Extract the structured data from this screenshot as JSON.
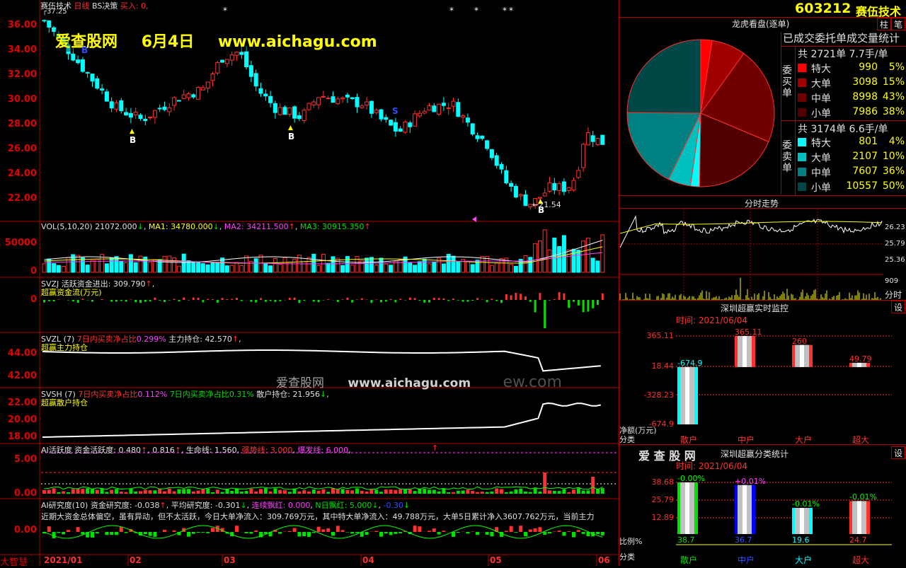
{
  "header": {
    "stock_name": "赛伍技术",
    "period": "日线",
    "strategy": "BS决策",
    "buy_label": "买入:",
    "buy_value": "0,",
    "watermark": "爱查股网",
    "date_banner": "6月4日",
    "url_banner": "www.aichagu.com",
    "price_flag": "37.25"
  },
  "price_pane": {
    "y_ticks": [
      "36.00",
      "34.00",
      "32.00",
      "30.00",
      "28.00",
      "26.00",
      "24.00",
      "22.00"
    ],
    "low_label": "21.54",
    "markers": [
      "B",
      "B",
      "B",
      "S",
      "B"
    ]
  },
  "vol_pane": {
    "label": "VOL(5,10,20)",
    "vol": "21072.000",
    "ma1_label": "MA1:",
    "ma1": "34780.000",
    "ma2_label": "MA2:",
    "ma2": "34211.500",
    "ma3_label": "MA3:",
    "ma3": "30915.350",
    "down_arrow": "↓",
    "up_arrow": "↑",
    "y_ticks": [
      "50000",
      "0"
    ]
  },
  "svzj_pane": {
    "code": "SVZJ",
    "title": "活跃资金进出:",
    "value": "309.790",
    "subtitle": "超赢资金流(万元)",
    "y_tick": "0"
  },
  "svzl_pane": {
    "code": "SVZL",
    "period": "(7)",
    "ratio_label": "7日内买卖净占比",
    "ratio": "0.299%",
    "hold_label": "主力持仓:",
    "hold": "42.570",
    "subtitle": "超赢主力持仓",
    "y_ticks": [
      "44.00",
      "42.00"
    ]
  },
  "svsh_pane": {
    "code": "SVSH",
    "period": "(7)",
    "ratio_label": "7日内买卖净占比",
    "ratio": "0.112%",
    "ratio2_label": "7日内买卖净占比",
    "ratio2": "0.31%",
    "hold_label": "散户持仓:",
    "hold": "21.956",
    "subtitle": "超赢散户持仓",
    "y_ticks": [
      "22.00",
      "20.00",
      "18.00"
    ],
    "watermark_cn": "爱查股网",
    "watermark_url": "www.aichagu.com",
    "watermark_tail": "ew.com"
  },
  "ai_pane": {
    "title": "AI活跃度",
    "fund_label": "资金活跃度:",
    "fund": "0.480",
    "v2": "0.816",
    "life_label": "生命线:",
    "life": "1.560",
    "strong_label": "强势线:",
    "strong": "3.000",
    "burst_label": "爆发线:",
    "burst": "6.000",
    "y_ticks": [
      "5.00",
      "0.00"
    ]
  },
  "research_pane": {
    "title": "AI研究度(10)",
    "r_label": "资金研究度:",
    "r": "-0.038",
    "avg_label": "平均研究度:",
    "avg": "-0.301",
    "cont_label": "连续飘红:",
    "cont": "0.000",
    "nday_label": "N日飘红:",
    "nday": "5.000",
    "neg": "-0.30",
    "comment": "近期大资金总体偏空，虽有异动，但不太活跃，今日大单净流入：309.769万元，其中特大单净流入：49.788万元，大单5日累计净入3607.762万元，当前主力",
    "y_tick": "0.00"
  },
  "x_axis": {
    "labels": [
      "2021/01",
      "02",
      "03",
      "04",
      "05",
      "06"
    ]
  },
  "bottom_left": {
    "label": "大智慧"
  },
  "right_panel": {
    "code": "603212",
    "name": "赛伍技术",
    "btn_zhu": "柱",
    "btn_bi": "笔",
    "pie_title": "龙虎看盘(逐单)",
    "stats_title": "已成交委托单成交量统计",
    "buy_side_label": "委买单",
    "sell_side_label": "委卖单",
    "buy_summary": "共 2721单 7.7手/单",
    "sell_summary": "共 3174单 6.6手/单",
    "buy_rows": [
      {
        "label": "特大",
        "count": "990",
        "pct": "5%",
        "color": "#ff0000"
      },
      {
        "label": "大单",
        "count": "3098",
        "pct": "15%",
        "color": "#a00000"
      },
      {
        "label": "中单",
        "count": "8998",
        "pct": "43%",
        "color": "#700000"
      },
      {
        "label": "小单",
        "count": "7986",
        "pct": "38%",
        "color": "#500000"
      }
    ],
    "sell_rows": [
      {
        "label": "特大",
        "count": "801",
        "pct": "4%",
        "color": "#00ffff"
      },
      {
        "label": "大单",
        "count": "2107",
        "pct": "10%",
        "color": "#00c0c0"
      },
      {
        "label": "中单",
        "count": "7607",
        "pct": "36%",
        "color": "#008080"
      },
      {
        "label": "小单",
        "count": "10557",
        "pct": "50%",
        "color": "#004848"
      }
    ],
    "intraday_title": "分时走势",
    "intraday_ticks": [
      "26.23",
      "25.79",
      "25.36"
    ],
    "intraday_vol": "909",
    "intraday_unit": "分时",
    "monitor_title": "深圳超赢实时监控",
    "monitor_btn": "设",
    "monitor_time": "时间: 2021/06/04",
    "monitor_ticks": [
      "365.11",
      "18.44",
      "-328.23",
      "-674.9"
    ],
    "monitor_bars": [
      {
        "cat": "散户",
        "value": "-674.9",
        "num": -674.9,
        "color": "#00ffff"
      },
      {
        "cat": "中户",
        "value": "365.11",
        "num": 365.11,
        "color": "#ff3030"
      },
      {
        "cat": "大户",
        "value": "260",
        "num": 260,
        "color": "#ff3030"
      },
      {
        "cat": "超大",
        "value": "49.79",
        "num": 49.79,
        "color": "#ff3030"
      }
    ],
    "monitor_unit": "净额(万元)",
    "monitor_cat_label": "分类",
    "stats2_watermark": "爱 查 股 网",
    "stats2_title": "深圳超赢分类统计",
    "stats2_btn": "设",
    "stats2_time": "时间: 2021/06/04",
    "stats2_ticks": [
      "38.68",
      "25.79",
      "12.89"
    ],
    "stats2_bars": [
      {
        "cat": "散户",
        "value": "38.7",
        "delta": "-0.00%",
        "num": 38.7,
        "color": "#00e000"
      },
      {
        "cat": "中户",
        "value": "36.7",
        "delta": "+0.01%",
        "num": 36.7,
        "color": "#0000ff"
      },
      {
        "cat": "大户",
        "value": "19.6",
        "delta": "-0.01%",
        "num": 19.6,
        "color": "#00ffff"
      },
      {
        "cat": "超大",
        "value": "24.7",
        "delta": "-0.01%",
        "num": 24.7,
        "color": "#ff3030"
      }
    ],
    "stats2_unit": "比例%",
    "stats2_cat_label": "分类"
  },
  "chart_data": {
    "type": "bar",
    "title": "深圳超赢实时监控",
    "categories": [
      "散户",
      "中户",
      "大户",
      "超大"
    ],
    "values": [
      -674.9,
      365.11,
      260,
      49.79
    ],
    "ylabel": "净额(万元)",
    "ylim": [
      -674.9,
      365.11
    ]
  }
}
